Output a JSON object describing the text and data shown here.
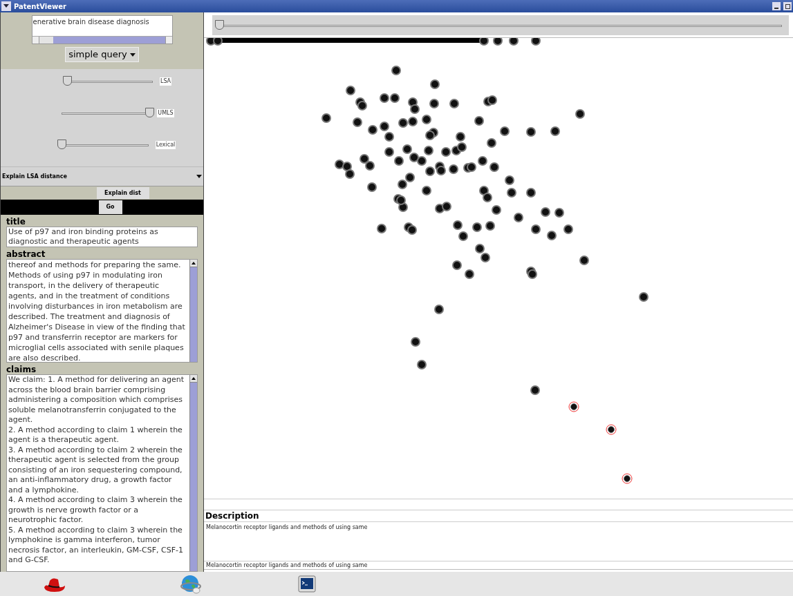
{
  "window": {
    "title": "PatentViewer"
  },
  "query": {
    "value": "enerative brain disease diagnosis"
  },
  "query_type": {
    "label": "simple query"
  },
  "timeline": {
    "level": 0
  },
  "weights": [
    {
      "label": "LSA",
      "level": 0.03
    },
    {
      "label": "UMLS",
      "level": 1
    },
    {
      "label": "Lexical",
      "level": 0.02
    }
  ],
  "explain_select": {
    "value": "Explain LSA distance"
  },
  "buttons": [
    {
      "label": "Explain dist"
    },
    {
      "label": "Go"
    }
  ],
  "fields": [
    {
      "kind": "title",
      "label": "title",
      "text": "Use of p97 and iron binding proteins as diagnostic and therapeutic agents"
    },
    {
      "kind": "abstract",
      "label": "abstract",
      "text": "thereof and methods for preparing the same. Methods of using p97 in modulating iron transport, in the delivery of therapeutic agents, and in the treatment of conditions involving disturbances in iron metabolism are described. The treatment and diagnosis of Alzheimer's Disease in view of the finding that p97 and transferrin receptor are markers for microglial cells associated with senile plaques are also described."
    },
    {
      "kind": "claims",
      "label": "claims",
      "paragraphs": [
        "We claim: 1. A method for delivering an agent across the blood brain barrier comprising administering a composition which comprises soluble melanotransferrin conjugated to the agent.",
        "2. A method according to claim 1 wherein the agent is a therapeutic agent.",
        "3. A method according to claim 2 wherein the therapeutic agent is selected from the group consisting of an iron sequestering compound, an anti-inflammatory drug, a growth factor and a lymphokine.",
        "4. A method according to claim 3 wherein the growth is nerve growth factor or a neurotrophic factor.",
        "5. A method according to claim 3 wherein the lymphokine is gamma interferon, tumor necrosis factor, an interleukin, GM-CSF, CSF-1 and G-CSF."
      ]
    }
  ],
  "description": {
    "label": "Description",
    "text": "Melanocortin receptor ligands and methods of using same",
    "status": "Melanocortin receptor ligands and methods of using same"
  }
}
